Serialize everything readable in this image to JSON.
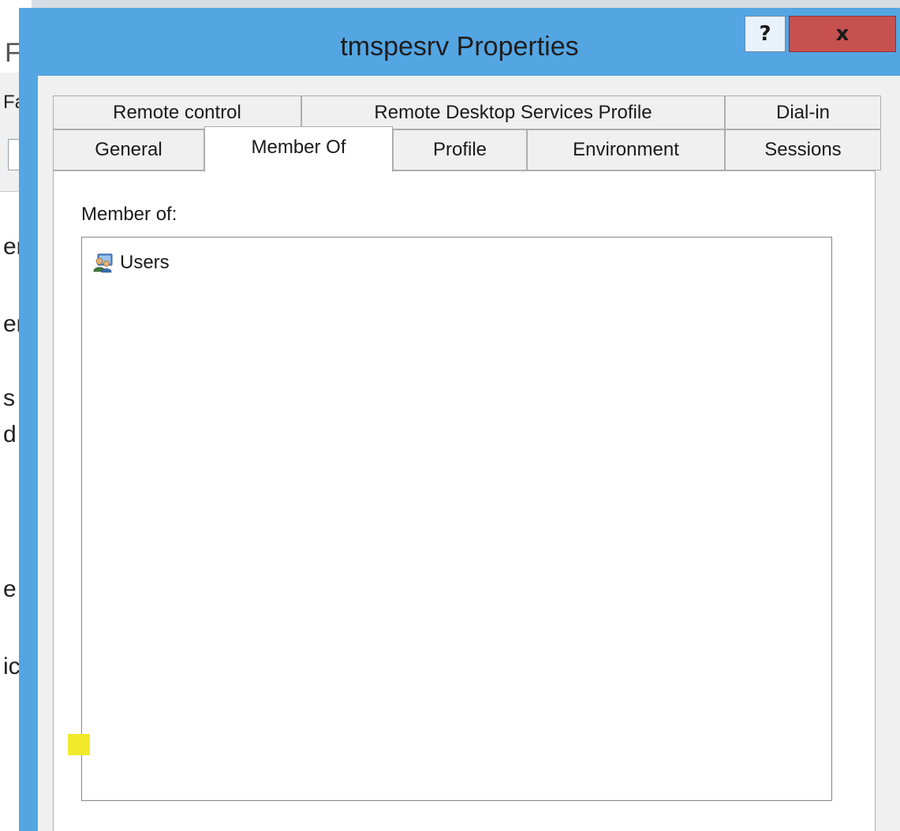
{
  "dialog": {
    "title": "tmspesrv Properties",
    "help_label": "?",
    "close_label": "x"
  },
  "tabs_row_top": [
    {
      "label": "Remote control"
    },
    {
      "label": "Remote Desktop Services Profile"
    },
    {
      "label": "Dial-in"
    }
  ],
  "tabs_row_bottom": [
    {
      "label": "General"
    },
    {
      "label": "Member Of",
      "active": true
    },
    {
      "label": "Profile"
    },
    {
      "label": "Environment"
    },
    {
      "label": "Sessions"
    }
  ],
  "member_of": {
    "label": "Member of:",
    "items": [
      {
        "name": "Users",
        "icon": "user-group-icon"
      }
    ]
  },
  "background_window": {
    "title_fragment": "F",
    "text_fragments": [
      "Fa",
      "er",
      "er",
      "s",
      "d",
      "e",
      "ic"
    ]
  },
  "colors": {
    "dialog_frame": "#54a6e3",
    "close_button": "#c75050",
    "client_bg": "#f0f0f0"
  }
}
